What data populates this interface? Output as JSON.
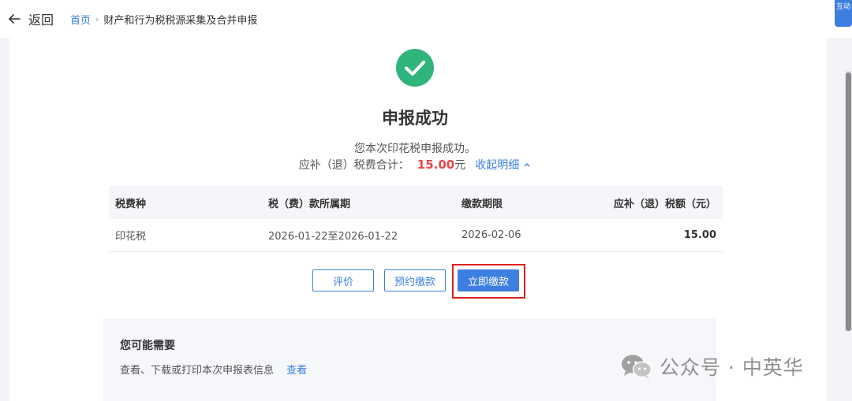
{
  "header": {
    "back_label": "返回",
    "breadcrumb_home": "首页",
    "breadcrumb_current": "财产和行为税税源采集及合并申报"
  },
  "side_tab_label": "互动",
  "result": {
    "title": "申报成功",
    "description": "您本次印花税申报成功。",
    "total_label": "应补（退）税费合计：",
    "total_value": "15.00",
    "total_unit": "元",
    "collapse_label": "收起明细"
  },
  "table": {
    "headers": [
      "税费种",
      "税（费）款所属期",
      "缴款期限",
      "应补（退）税额（元）"
    ],
    "rows": [
      [
        "印花税",
        "2026-01-22至2026-01-22",
        "2026-02-06",
        "15.00"
      ]
    ]
  },
  "actions": {
    "evaluate_label": "评价",
    "schedule_label": "预约缴款",
    "pay_now_label": "立即缴款"
  },
  "panel": {
    "title": "您可能需要",
    "text": "查看、下载或打印本次申报表信息",
    "link": "查看"
  },
  "watermark": {
    "text": "公众号 · 中英华"
  },
  "colors": {
    "accent": "#3d7fe0",
    "success": "#2fb57c",
    "amount": "#e5484d",
    "highlight": "#e02020"
  }
}
